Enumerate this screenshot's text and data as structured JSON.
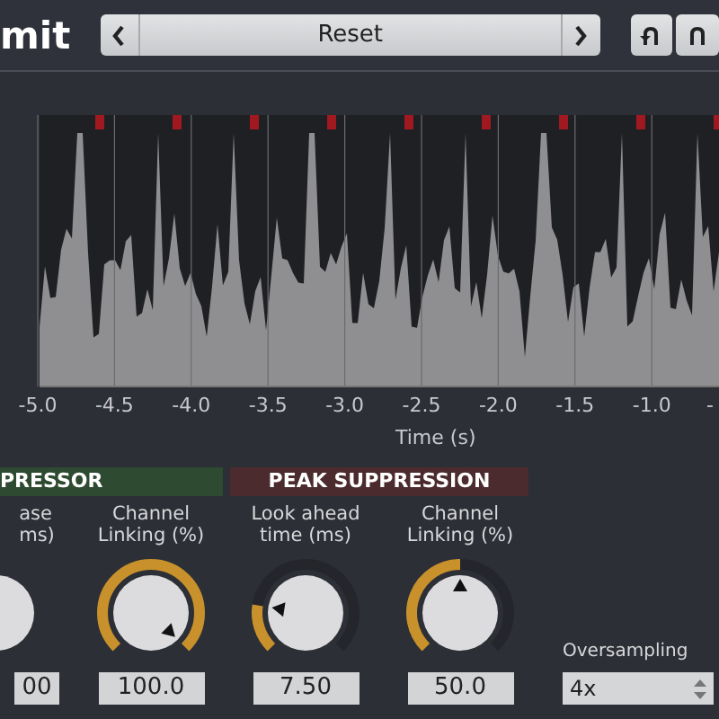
{
  "title": "mit",
  "preset": {
    "name": "Reset"
  },
  "chart": {
    "x_ticks": [
      "-5.0",
      "-4.5",
      "-4.0",
      "-3.5",
      "-3.0",
      "-2.5",
      "-2.0",
      "-1.5",
      "-1.0",
      "-"
    ],
    "xlabel": "Time (s)"
  },
  "sections": [
    {
      "title": "PRESSOR",
      "color": "#2e4a30"
    },
    {
      "title": "PEAK SUPPRESSION",
      "color": "#4b2b2d"
    }
  ],
  "controls": [
    {
      "kind": "knob",
      "label": "ase\nms)",
      "value": "00"
    },
    {
      "kind": "knob",
      "label": "Channel\nLinking (%)",
      "value": "100.0",
      "level": 1
    },
    {
      "kind": "knob",
      "label": "Look ahead\ntime (ms)",
      "value": "7.50",
      "level": 0.2
    },
    {
      "kind": "knob",
      "label": "Channel\nLinking (%)",
      "value": "50.0",
      "level": 0.5
    }
  ],
  "oversampling": {
    "label": "Oversampling",
    "value": "4x"
  }
}
